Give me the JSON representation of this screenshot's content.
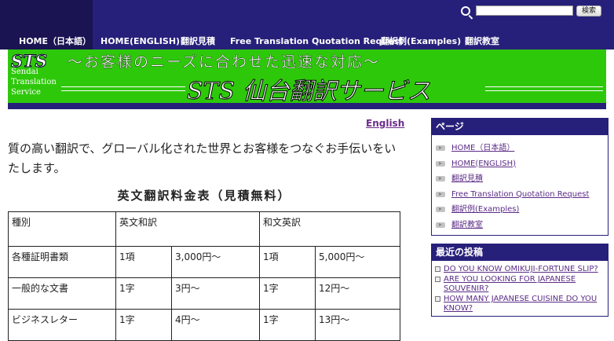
{
  "search": {
    "placeholder": "",
    "button_label": "検索"
  },
  "nav": {
    "items": [
      {
        "label": "HOME（日本語）"
      },
      {
        "label": "HOME(ENGLISH)"
      },
      {
        "label": "翻訳見積"
      },
      {
        "label": "Free Translation Quotation Request"
      },
      {
        "label": "翻訳例(Examples)"
      },
      {
        "label": "翻訳教室"
      }
    ]
  },
  "banner": {
    "logo_text": "STS",
    "catchphrase": "～お客様のニーズに合わせた迅速な対応～",
    "company_line1": "Sendai",
    "company_line2": "Translation",
    "company_line3": "Service",
    "title": "STS 仙台翻訳サービス"
  },
  "main": {
    "lang_link": "English",
    "intro": "質の高い翻訳で、グローバル化された世界とお客様をつなぐお手伝いをいたします。",
    "table_title": "英文翻訳料金表（見積無料）",
    "table": {
      "header": {
        "c1": "種別",
        "c2": "英文和訳",
        "c3": "和文英訳"
      },
      "rows": [
        {
          "type": "各種証明書類",
          "ej_unit": "1項",
          "ej_price": "3,000円〜",
          "je_unit": "1項",
          "je_price": "5,000円〜"
        },
        {
          "type": "一般的な文書",
          "ej_unit": "1字",
          "ej_price": "3円〜",
          "je_unit": "1字",
          "je_price": "12円〜"
        },
        {
          "type": "ビジネスレター",
          "ej_unit": "1字",
          "ej_price": "4円〜",
          "je_unit": "1字",
          "je_price": "13円〜"
        }
      ]
    }
  },
  "sidebar": {
    "pages_title": "ページ",
    "pages": [
      {
        "label": "HOME（日本語）"
      },
      {
        "label": "HOME(ENGLISH)"
      },
      {
        "label": "翻訳見積"
      },
      {
        "label": "Free Translation Quotation Request"
      },
      {
        "label": "翻訳例(Examples)"
      },
      {
        "label": "翻訳教室"
      }
    ],
    "posts_title": "最近の投稿",
    "posts": [
      {
        "label": "DO YOU KNOW OMIKUJI-FORTUNE SLIP?"
      },
      {
        "label": "ARE YOU LOOKING FOR JAPANESE SOUVENIR?"
      },
      {
        "label": "HOW MANY JAPANESE CUISINE DO YOU KNOW?"
      }
    ]
  },
  "colors": {
    "header": "#27207a",
    "banner": "#2ec80b",
    "link": "#5b2b86"
  }
}
